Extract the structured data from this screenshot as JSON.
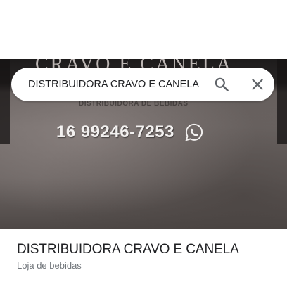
{
  "search": {
    "value": "DISTRIBUIDORA CRAVO E CANELA",
    "search_icon": "search-icon",
    "close_icon": "close-icon"
  },
  "photo": {
    "sign_header": "CRAVO E CANELA",
    "sign_subtitle": "DISTRIBUIDORA DE BEBIDAS",
    "phone": "16 99246-7253",
    "phone_icon": "whatsapp-icon"
  },
  "place": {
    "name": "DISTRIBUIDORA CRAVO E CANELA",
    "category": "Loja de bebidas"
  },
  "colors": {
    "title_text": "#202124",
    "subtitle_text": "#70757a",
    "icon": "#5f6368"
  }
}
